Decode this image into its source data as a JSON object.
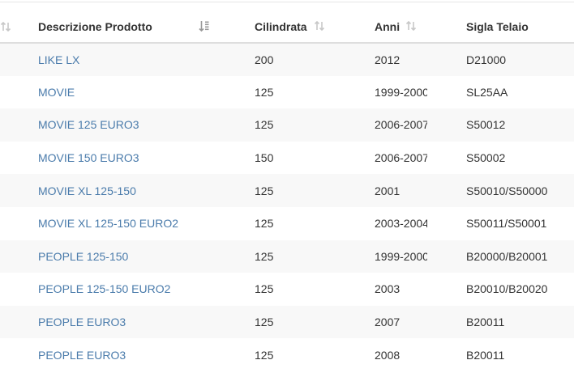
{
  "table": {
    "columns": [
      {
        "label": "Descrizione Prodotto",
        "sort_icon": "sort-both-icon"
      },
      {
        "label": "Cilindrata",
        "sort_icon": "sort-numeric-desc-icon"
      },
      {
        "label": "Anni",
        "sort_icon": "sort-both-icon"
      },
      {
        "label": "Sigla Telaio",
        "sort_icon": "sort-both-icon"
      }
    ],
    "rows": [
      {
        "descrizione": "LIKE LX",
        "cilindrata": "200",
        "anni": "2012",
        "sigla": "D21000"
      },
      {
        "descrizione": "MOVIE",
        "cilindrata": "125",
        "anni": "1999-2000",
        "sigla": "SL25AA"
      },
      {
        "descrizione": "MOVIE 125 EURO3",
        "cilindrata": "125",
        "anni": "2006-2007",
        "sigla": "S50012"
      },
      {
        "descrizione": "MOVIE 150 EURO3",
        "cilindrata": "150",
        "anni": "2006-2007",
        "sigla": "S50002"
      },
      {
        "descrizione": "MOVIE XL 125-150",
        "cilindrata": "125",
        "anni": "2001",
        "sigla": "S50010/S50000"
      },
      {
        "descrizione": "MOVIE XL 125-150 EURO2",
        "cilindrata": "125",
        "anni": "2003-2004",
        "sigla": "S50011/S50001"
      },
      {
        "descrizione": "PEOPLE 125-150",
        "cilindrata": "125",
        "anni": "1999-2000",
        "sigla": "B20000/B20001"
      },
      {
        "descrizione": "PEOPLE 125-150 EURO2",
        "cilindrata": "125",
        "anni": "2003",
        "sigla": "B20010/B20020"
      },
      {
        "descrizione": "PEOPLE EURO3",
        "cilindrata": "125",
        "anni": "2007",
        "sigla": "B20011"
      },
      {
        "descrizione": "PEOPLE EURO3",
        "cilindrata": "125",
        "anni": "2008",
        "sigla": "B20011"
      }
    ]
  },
  "colors": {
    "link": "#4a7bab",
    "stripe": "#f8f8f8",
    "header_border": "#dedede",
    "sort_icon_inactive": "#c8c8c8",
    "sort_icon_active": "#999999"
  }
}
